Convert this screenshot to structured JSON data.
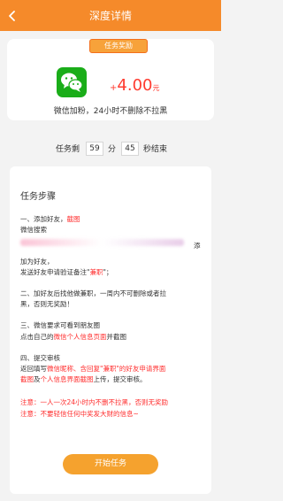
{
  "header": {
    "title": "深度详情",
    "back_icon": "chevron-left-icon"
  },
  "reward": {
    "badge": "任务奖励",
    "app_icon": "wechat-icon",
    "plus": "+",
    "amount": "4.00",
    "unit": "元",
    "description": "微信加粉，24小时不删除不拉黑"
  },
  "timer": {
    "prefix": "任务剩",
    "minutes": "59",
    "minute_label": "分",
    "seconds": "45",
    "suffix": "秒结束"
  },
  "steps": {
    "title": "任务步骤",
    "s1_line1_a": "一、添加好友，",
    "s1_line1_b": "截图",
    "s1_line2": "微信搜索",
    "s1_add": "添",
    "s1_line3": "加为好友，",
    "s1_line4_a": "发送好友申请验证备注\"",
    "s1_line4_b": "兼职",
    "s1_line4_c": "\"；",
    "s2_line1": "二、加好友后找他做兼职，一周内不可删除或者拉",
    "s2_line2": "黑，否则无奖励！",
    "s3_line1": "三、微信要求可看到朋友圈",
    "s3_line2_a": "点击自己的",
    "s3_line2_b": "微信个人信息页面",
    "s3_line2_c": "并截图",
    "s4_line1": "四、提交审核",
    "s4_line2_a": "返回填写",
    "s4_line2_b": "微信昵称、含回复\"兼职\"的好友申请界面",
    "s4_line3_a": "截图",
    "s4_line3_b": "及",
    "s4_line3_c": "个人信息界面截图",
    "s4_line3_d": "上传，提交审核。",
    "note1": "注意：一人一次24小时内不删不拉黑，否则无奖励",
    "note2": "注意：不要轻信任何中奖发大财的信息~"
  },
  "start_button": "开始任务"
}
